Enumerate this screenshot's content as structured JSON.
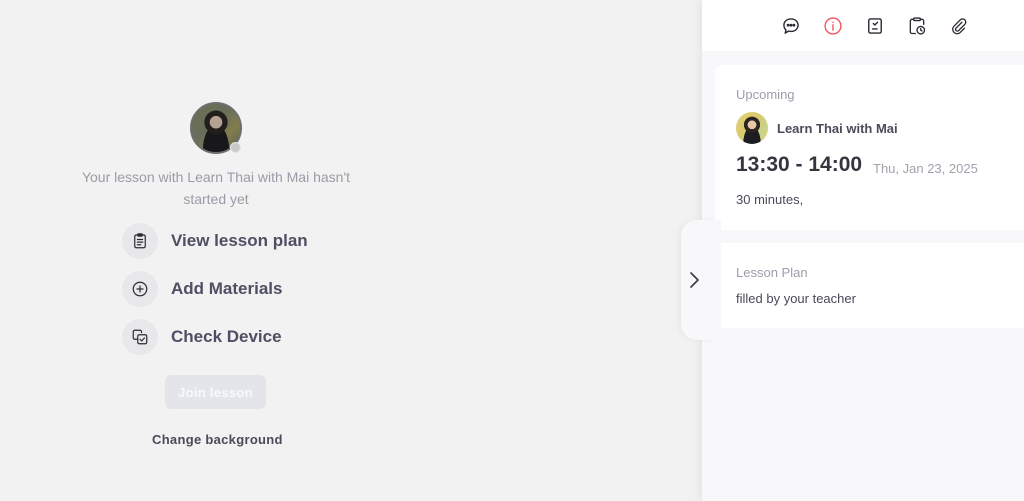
{
  "prelesson": {
    "notice": "Your lesson with Learn Thai with Mai hasn't started yet",
    "actions": [
      {
        "icon": "clipboard-icon",
        "label": "View lesson plan"
      },
      {
        "icon": "plus-circle-icon",
        "label": "Add Materials"
      },
      {
        "icon": "device-check-icon",
        "label": "Check Device"
      }
    ],
    "join_label": "Join lesson",
    "change_background_label": "Change background"
  },
  "sidebar": {
    "toolbar": [
      {
        "icon": "chat-icon",
        "color": "#2b2b33"
      },
      {
        "icon": "info-icon",
        "color": "#f0525a",
        "active": true
      },
      {
        "icon": "task-icon",
        "color": "#2b2b33"
      },
      {
        "icon": "clipboard-clock-icon",
        "color": "#2b2b33"
      },
      {
        "icon": "link-icon",
        "color": "#2b2b33"
      }
    ],
    "upcoming": {
      "label": "Upcoming",
      "teacher": "Learn Thai with Mai",
      "time": "13:30 - 14:00",
      "date": "Thu, Jan 23, 2025",
      "duration": "30 minutes,"
    },
    "lesson_plan": {
      "label": "Lesson Plan",
      "text": "filled by your teacher"
    }
  }
}
